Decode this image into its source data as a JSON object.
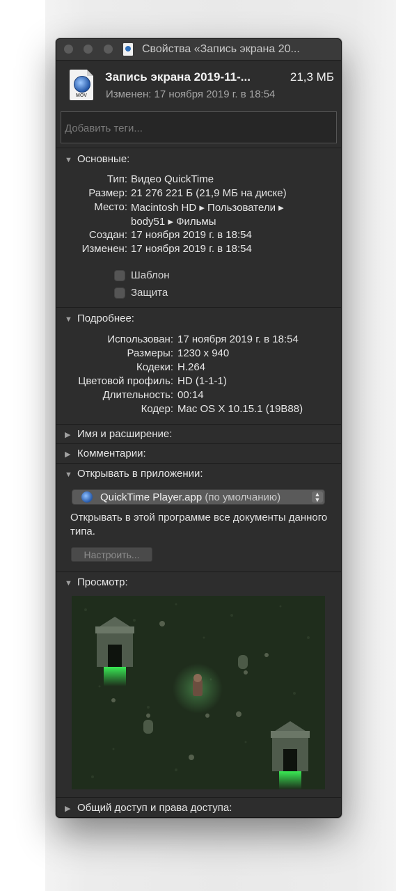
{
  "window": {
    "title": "Свойства «Запись экрана 20..."
  },
  "file": {
    "name": "Запись экрана 2019-11-...",
    "size": "21,3 МБ",
    "modified": "Изменен: 17 ноября 2019 г. в 18:54",
    "icon_label": "MOV",
    "icon": "quicktime-movie-icon"
  },
  "tags": {
    "placeholder": "Добавить теги..."
  },
  "general": {
    "header": "Основные:",
    "rows": [
      {
        "key": "Тип:",
        "value": "Видео QuickTime"
      },
      {
        "key": "Размер:",
        "value": "21 276 221 Б (21,9 МБ на диске)"
      },
      {
        "key": "Место:",
        "value": "Macintosh HD ▸ Пользователи ▸",
        "value2": "body51 ▸ Фильмы"
      },
      {
        "key": "Создан:",
        "value": "17 ноября 2019 г. в 18:54"
      },
      {
        "key": "Изменен:",
        "value": "17 ноября 2019 г. в 18:54"
      }
    ],
    "template_label": "Шаблон",
    "locked_label": "Защита"
  },
  "more": {
    "header": "Подробнее:",
    "rows": [
      {
        "key": "Использован:",
        "value": "17 ноября 2019 г. в 18:54"
      },
      {
        "key": "Размеры:",
        "value": "1230 x 940"
      },
      {
        "key": "Кодеки:",
        "value": "H.264"
      },
      {
        "key": "Цветовой профиль:",
        "value": "HD (1-1-1)"
      },
      {
        "key": "Длительность:",
        "value": "00:14"
      },
      {
        "key": "Кодер:",
        "value": "Mac OS X 10.15.1 (19B88)"
      }
    ]
  },
  "sections": {
    "name_ext": "Имя и расширение:",
    "comments": "Комментарии:",
    "open_with": "Открывать в приложении:",
    "preview": "Просмотр:",
    "sharing": "Общий доступ и права доступа:"
  },
  "open_with": {
    "app_name": "QuickTime Player.app",
    "app_default": "(по умолчанию)",
    "description": "Открывать в этой программе все документы данного типа.",
    "configure_button": "Настроить..."
  },
  "colors": {
    "window_bg": "#2d2d2d",
    "preview_bg": "#1f2d1c",
    "glow": "#39e65a"
  }
}
